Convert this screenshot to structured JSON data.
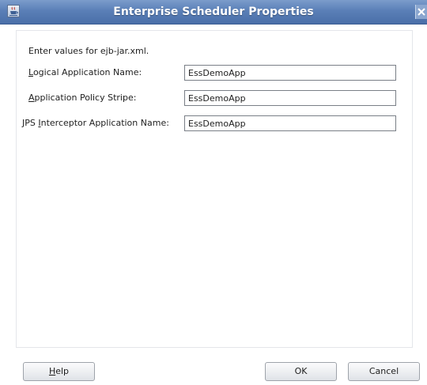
{
  "window": {
    "title": "Enterprise Scheduler Properties",
    "icons": {
      "app": "java-app-icon",
      "close": "close-icon"
    },
    "colors": {
      "titlebar": "#5a7fb7",
      "title_text": "#ffffff"
    }
  },
  "form": {
    "intro": "Enter values for ejb-jar.xml.",
    "fields": [
      {
        "label": "Logical Application Name:",
        "mnemonic": "L",
        "value": "EssDemoApp"
      },
      {
        "label": "Application Policy Stripe:",
        "mnemonic": "A",
        "value": "EssDemoApp"
      },
      {
        "label": "JPS Interceptor Application Name:",
        "mnemonic": "I",
        "value": "EssDemoApp"
      }
    ]
  },
  "buttons": {
    "help": "Help",
    "ok": "OK",
    "cancel": "Cancel"
  }
}
